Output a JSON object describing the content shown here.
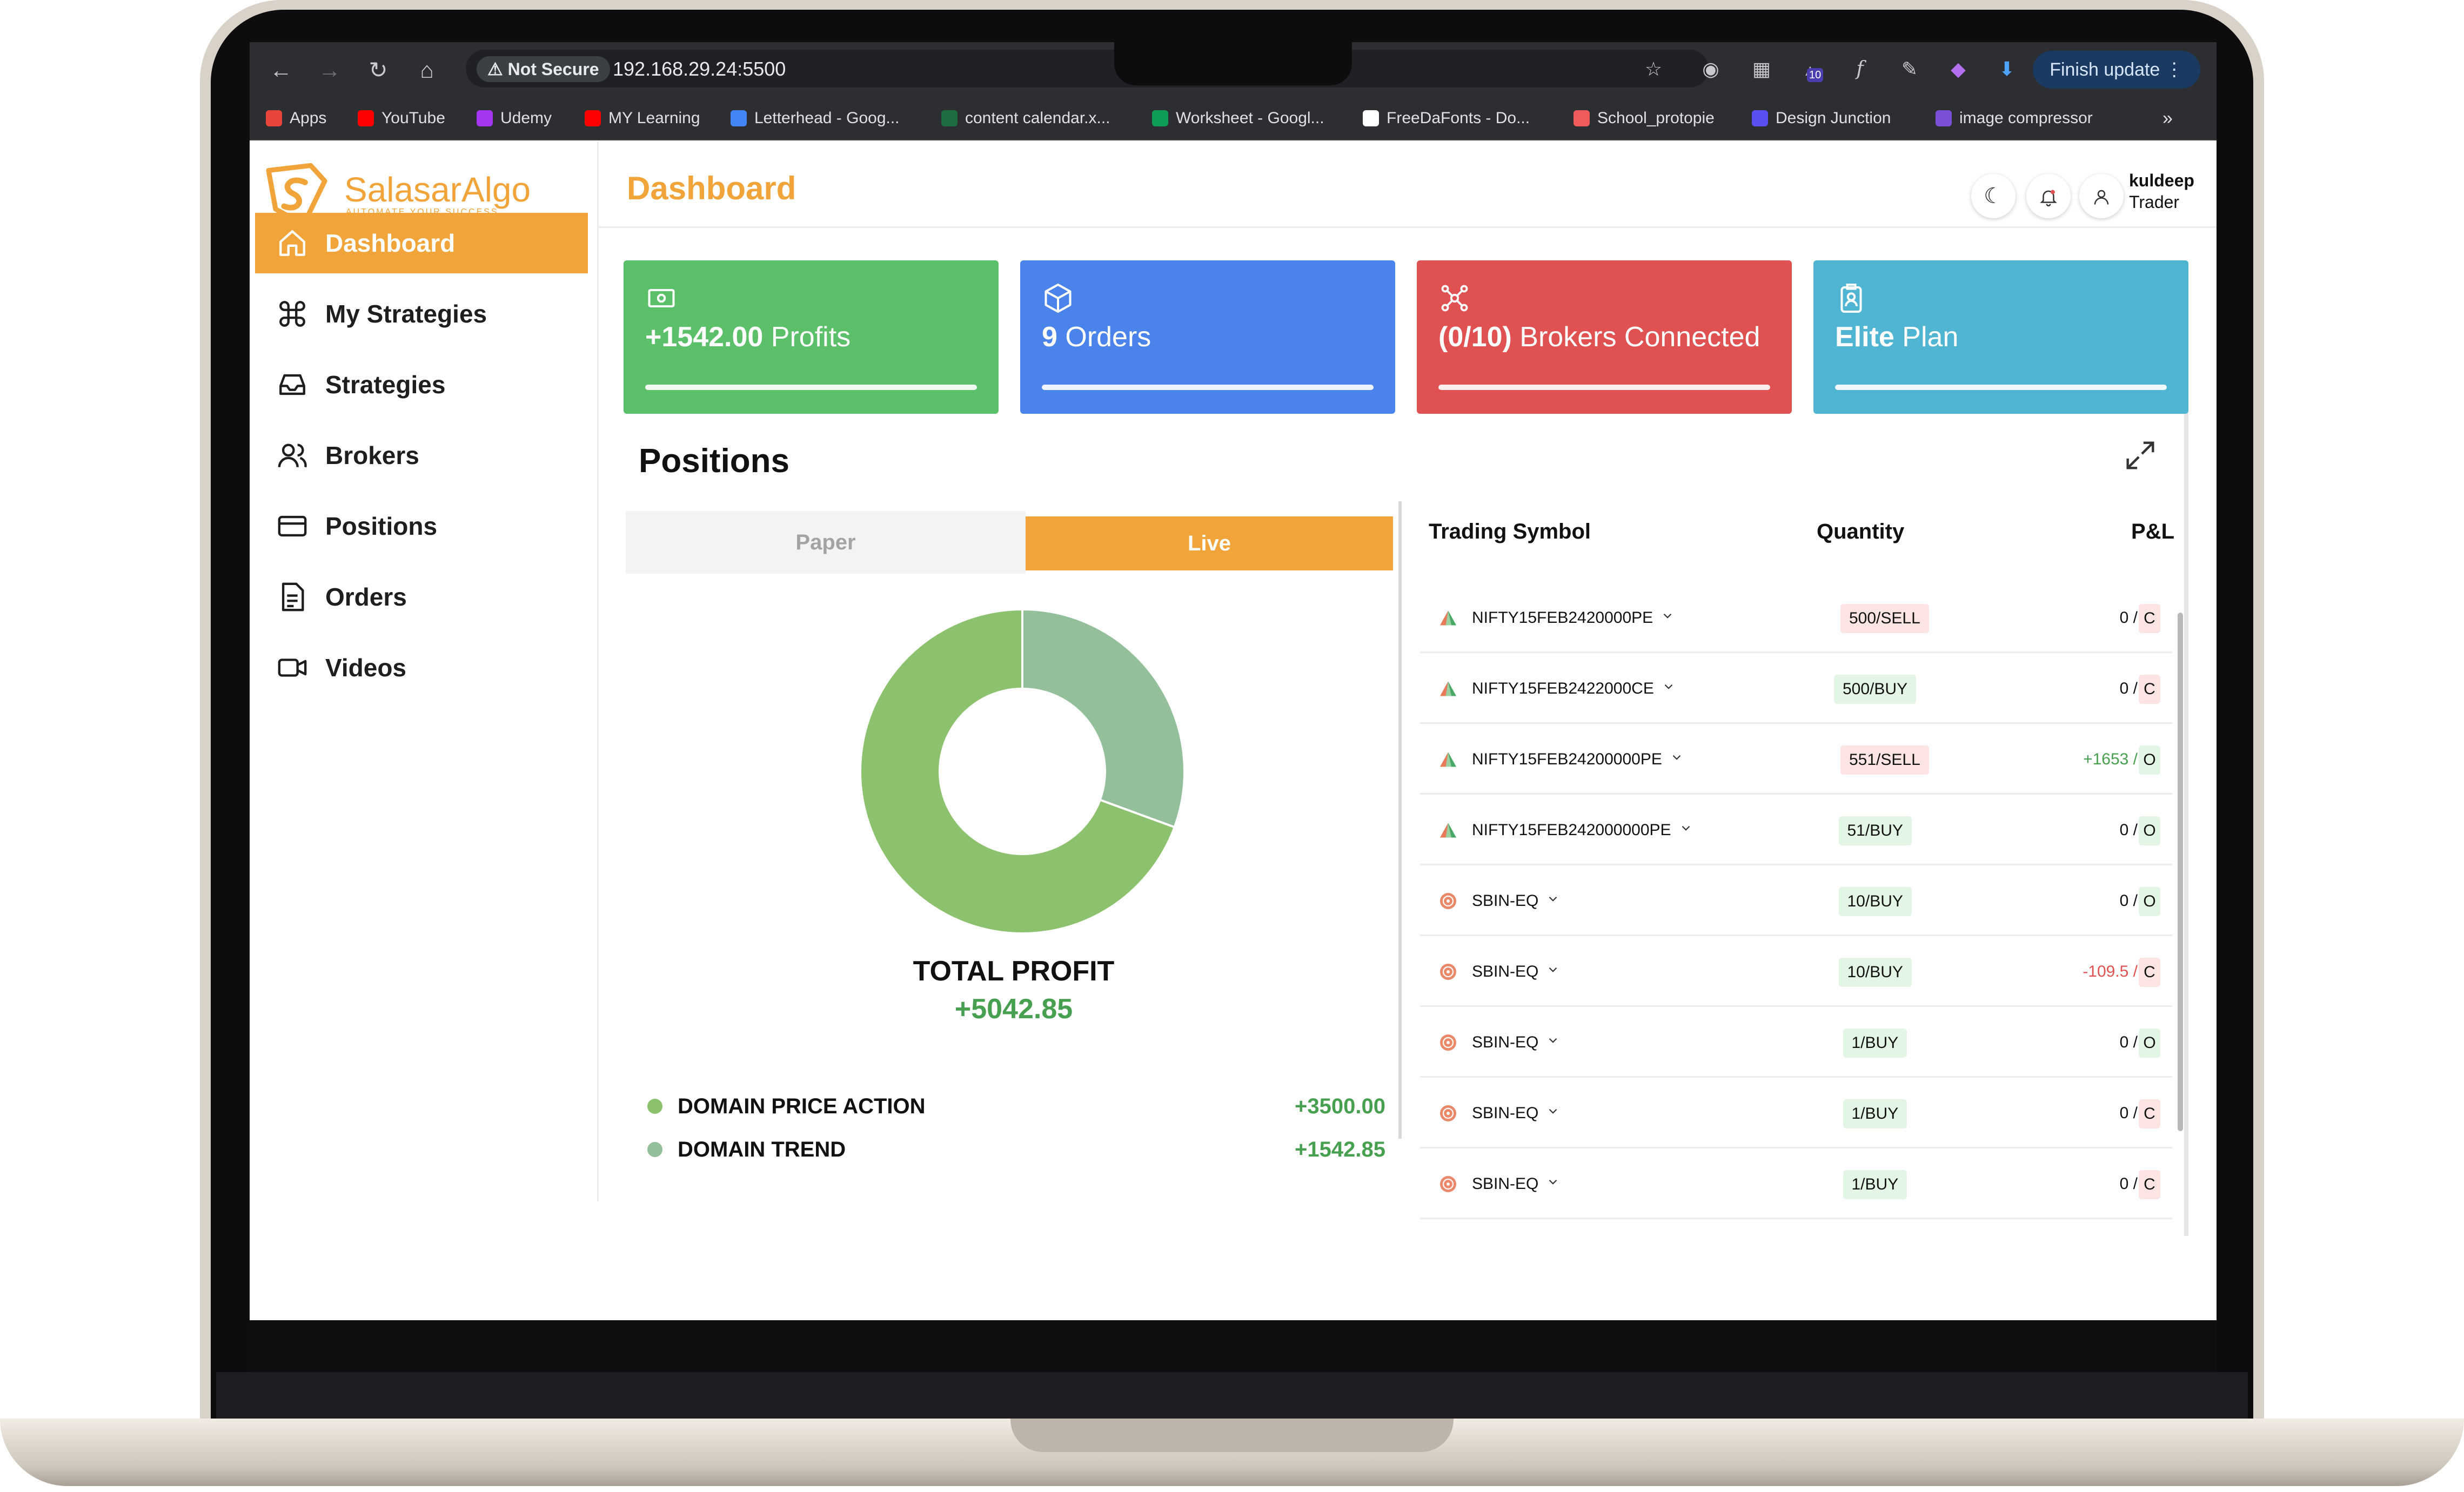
{
  "browser": {
    "security_label": "Not Secure",
    "url": "192.168.29.24:5500",
    "finish_update_label": "Finish update",
    "extension_badge": "10",
    "bookmarks": [
      {
        "label": "Apps",
        "icon": "apps-grid-icon",
        "color": "#e8453c"
      },
      {
        "label": "YouTube",
        "icon": "youtube-icon",
        "color": "#ff0000"
      },
      {
        "label": "Udemy",
        "icon": "udemy-icon",
        "color": "#a435f0"
      },
      {
        "label": "MY Learning",
        "icon": "youtube-icon",
        "color": "#ff0000"
      },
      {
        "label": "Letterhead - Goog...",
        "icon": "google-docs-icon",
        "color": "#4285f4"
      },
      {
        "label": "content calendar.x...",
        "icon": "excel-icon",
        "color": "#1d6f42"
      },
      {
        "label": "Worksheet - Googl...",
        "icon": "google-sheets-icon",
        "color": "#0f9d58"
      },
      {
        "label": "FreeDaFonts - Do...",
        "icon": "dafont-icon",
        "color": "#ffffff"
      },
      {
        "label": "School_protopie",
        "icon": "protopie-icon",
        "color": "#f05a5b"
      },
      {
        "label": "Design Junction",
        "icon": "design-junction-icon",
        "color": "#5a4ff0"
      },
      {
        "label": "image compressor",
        "icon": "jpg-icon",
        "color": "#7b4fd6"
      }
    ]
  },
  "brand": {
    "name_part1": "Salasar",
    "name_part2": "Algo",
    "tagline": "AUTOMATE YOUR SUCCESS",
    "color": "#f0a43a"
  },
  "sidebar": {
    "items": [
      {
        "label": "Dashboard",
        "icon": "home-icon",
        "active": true
      },
      {
        "label": "My Strategies",
        "icon": "command-icon"
      },
      {
        "label": "Strategies",
        "icon": "inbox-icon"
      },
      {
        "label": "Brokers",
        "icon": "users-icon"
      },
      {
        "label": "Positions",
        "icon": "credit-card-icon"
      },
      {
        "label": "Orders",
        "icon": "document-icon"
      },
      {
        "label": "Videos",
        "icon": "video-icon"
      }
    ]
  },
  "header": {
    "title": "Dashboard",
    "user_name": "kuldeep",
    "user_role": "Trader"
  },
  "cards": [
    {
      "value": "+1542.00",
      "label": "Profits",
      "color": "#5cbf6a",
      "icon": "cash-icon"
    },
    {
      "value": "9",
      "label": "Orders",
      "color": "#4a84ea",
      "icon": "box-icon"
    },
    {
      "value": "(0/10)",
      "label": "Brokers Connected",
      "color": "#e05252",
      "icon": "network-icon"
    },
    {
      "value": "Elite",
      "label": "Plan",
      "color": "#50b5d2",
      "icon": "badge-icon"
    }
  ],
  "positions": {
    "title": "Positions",
    "tabs": {
      "paper": "Paper",
      "live": "Live"
    },
    "total_label": "TOTAL PROFIT",
    "total_value": "+5042.85",
    "legend": [
      {
        "name": "DOMAIN PRICE ACTION",
        "value": "+3500.00",
        "color": "#8cc26e"
      },
      {
        "name": "DOMAIN TREND",
        "value": "+1542.85",
        "color": "#93bf9a"
      }
    ],
    "table": {
      "headers": [
        "Trading Symbol",
        "Quantity",
        "P&L"
      ],
      "rows": [
        {
          "symbol": "NIFTY15FEB2420000PE",
          "type": "nifty",
          "qty": "500/SELL",
          "side": "sell",
          "pnl": "0 /",
          "pnl_kind": "zero",
          "status": "C"
        },
        {
          "symbol": "NIFTY15FEB2422000CE",
          "type": "nifty",
          "qty": "500/BUY",
          "side": "buy",
          "pnl": "0 /",
          "pnl_kind": "zero",
          "status": "C"
        },
        {
          "symbol": "NIFTY15FEB24200000PE",
          "type": "nifty",
          "qty": "551/SELL",
          "side": "sell",
          "pnl": "+1653 /",
          "pnl_kind": "pos",
          "status": "O"
        },
        {
          "symbol": "NIFTY15FEB242000000PE",
          "type": "nifty",
          "qty": "51/BUY",
          "side": "buy",
          "pnl": "0 /",
          "pnl_kind": "zero",
          "status": "O"
        },
        {
          "symbol": "SBIN-EQ",
          "type": "sbin",
          "qty": "10/BUY",
          "side": "buy",
          "pnl": "0 /",
          "pnl_kind": "zero",
          "status": "O"
        },
        {
          "symbol": "SBIN-EQ",
          "type": "sbin",
          "qty": "10/BUY",
          "side": "buy",
          "pnl": "-109.5 /",
          "pnl_kind": "neg",
          "status": "C"
        },
        {
          "symbol": "SBIN-EQ",
          "type": "sbin",
          "qty": "1/BUY",
          "side": "buy",
          "pnl": "0 /",
          "pnl_kind": "zero",
          "status": "O"
        },
        {
          "symbol": "SBIN-EQ",
          "type": "sbin",
          "qty": "1/BUY",
          "side": "buy",
          "pnl": "0 /",
          "pnl_kind": "zero",
          "status": "C"
        },
        {
          "symbol": "SBIN-EQ",
          "type": "sbin",
          "qty": "1/BUY",
          "side": "buy",
          "pnl": "0 /",
          "pnl_kind": "zero",
          "status": "C"
        }
      ]
    }
  }
}
